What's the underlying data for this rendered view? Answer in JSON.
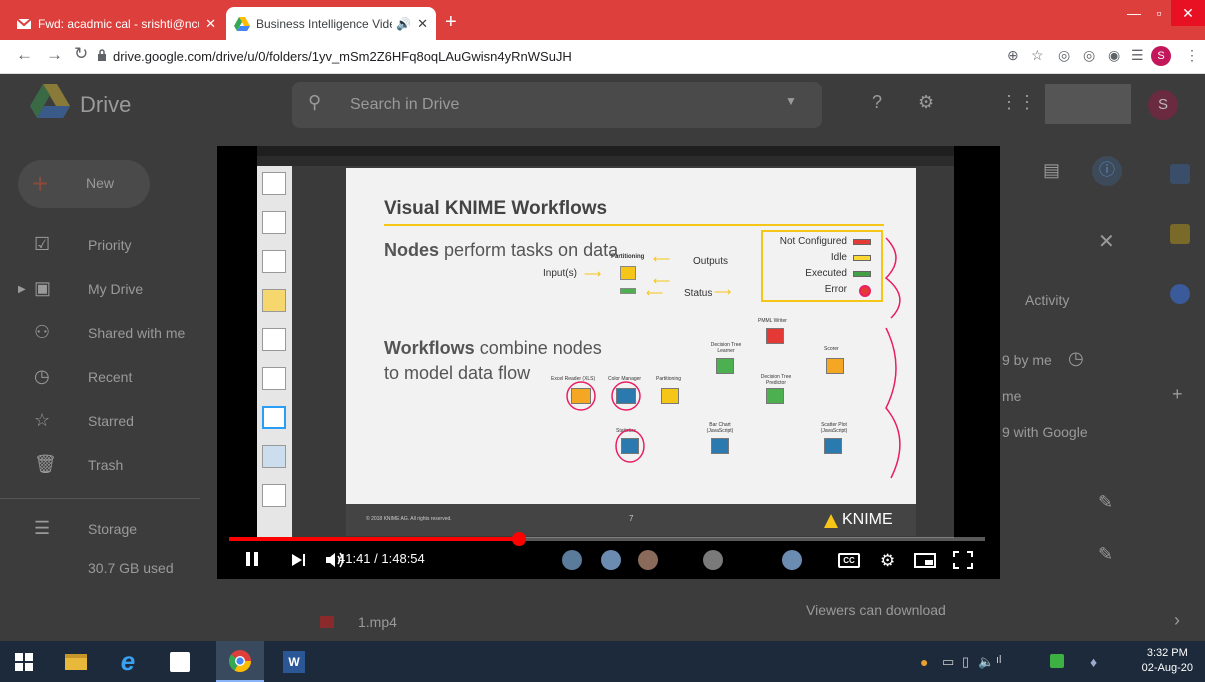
{
  "browser": {
    "tabs": [
      {
        "title": "Fwd: acadmic cal - srishti@ncuin",
        "active": false,
        "favicon": "gmail-icon"
      },
      {
        "title": "Business Intelligence Videos",
        "active": true,
        "favicon": "drive-icon",
        "audio": true
      }
    ],
    "url": "drive.google.com/drive/u/0/folders/1yv_mSm2Z6HFq8oqLAuGwisn4yRnWSuJH",
    "profile_initial": "S"
  },
  "drive": {
    "app_name": "Drive",
    "search_placeholder": "Search in Drive",
    "new_label": "New",
    "nav": [
      "Priority",
      "My Drive",
      "Shared with me",
      "Recent",
      "Starred",
      "Trash"
    ],
    "storage_label": "Storage",
    "storage_used": "30.7 GB used",
    "activity_tab": "Activity",
    "details_lines": [
      "9 by me",
      "me",
      "9 with Google"
    ],
    "file_name": "1.mp4",
    "viewers_note": "Viewers can download",
    "account_initial": "S"
  },
  "video": {
    "slide_title": "Visual KNIME Workflows",
    "slide_line1_bold": "Nodes",
    "slide_line1_rest": "perform tasks on data",
    "slide_line2_bold": "Workflows",
    "slide_line2_rest": "combine nodes",
    "slide_line3": "to model data flow",
    "node_partitioning": "Partitioning",
    "label_inputs": "Input(s)",
    "label_outputs": "Outputs",
    "label_status": "Status",
    "status_not_configured": "Not Configured",
    "status_idle": "Idle",
    "status_executed": "Executed",
    "status_error": "Error",
    "wf_nodes": [
      "Excel Reader (XLS)",
      "Color Manager",
      "Partitioning",
      "Decision Tree Learner",
      "PMML Writer",
      "Scorer",
      "Decision Tree Predictor",
      "Statistics",
      "Bar Chart (JavaScript)",
      "Scatter Plot (JavaScript)"
    ],
    "footer_copyright": "© 2018 KNIME AG. All rights reserved.",
    "page_number": "7",
    "brand": "KNIME",
    "current_time": "41:41",
    "duration": "1:48:54",
    "progress_fraction": 0.384
  },
  "taskbar": {
    "time": "3:32 PM",
    "date": "02-Aug-20"
  },
  "colors": {
    "chrome_red": "#dd3f3c",
    "progress_red": "#ff0000",
    "knime_yellow": "#f5c518"
  }
}
